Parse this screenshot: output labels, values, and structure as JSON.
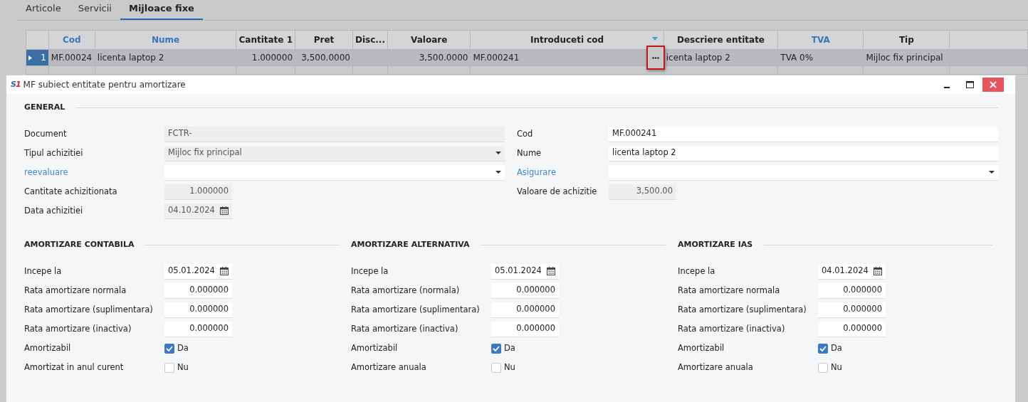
{
  "tabs": [
    {
      "label": "Articole",
      "selected": false
    },
    {
      "label": "Servicii",
      "selected": false
    },
    {
      "label": "Mijloace fixe",
      "selected": true
    }
  ],
  "grid": {
    "columns": [
      {
        "label": "Cod",
        "kind": "link",
        "menu": false
      },
      {
        "label": "Nume",
        "kind": "link",
        "menu": false
      },
      {
        "label": "Cantitate 1",
        "kind": "plain",
        "menu": false
      },
      {
        "label": "Pret",
        "kind": "plain",
        "menu": false
      },
      {
        "label": "Disc...",
        "kind": "plain",
        "menu": false
      },
      {
        "label": "Valoare",
        "kind": "plain",
        "menu": false
      },
      {
        "label": "Introduceti cod",
        "kind": "plain",
        "menu": true
      },
      {
        "label": "Descriere entitate",
        "kind": "plain",
        "menu": false
      },
      {
        "label": "TVA",
        "kind": "link",
        "menu": false
      },
      {
        "label": "Tip",
        "kind": "plain",
        "menu": false
      }
    ],
    "rows": [
      {
        "number": "1",
        "selected": true,
        "lookup_highlighted": true,
        "cells": [
          "MF.00024",
          "licenta laptop 2",
          "1.000000",
          "3,500.0000",
          "",
          "3,500.0000",
          "MF.000241",
          "icenta laptop 2",
          "TVA 0%",
          "Mijloc fix principal"
        ]
      }
    ]
  },
  "dialog": {
    "logo": "S1",
    "title": "MF subiect entitate pentru amortizare",
    "general": {
      "heading": "GENERAL",
      "left": [
        {
          "label": "Document",
          "kind": "text",
          "value": "FCTR-",
          "disabled": true,
          "link": false
        },
        {
          "label": "Tipul achizitiei",
          "kind": "select",
          "value": "Mijloc fix principal",
          "disabled": true,
          "link": false
        },
        {
          "label": "reevaluare",
          "kind": "select",
          "disabled": false,
          "link": true
        },
        {
          "label": "Cantitate achizitionata",
          "kind": "number",
          "value": "1.000000",
          "disabled": true,
          "link": false
        },
        {
          "label": "Data achizitiei",
          "kind": "date",
          "value": "04.10.2024",
          "disabled": true,
          "link": false
        }
      ],
      "right": [
        {
          "label": "Cod",
          "kind": "text",
          "value": "MF.000241",
          "disabled": false,
          "link": false
        },
        {
          "label": "Nume",
          "kind": "text",
          "value": "licenta laptop 2",
          "disabled": false,
          "link": false
        },
        {
          "label": "Asigurare",
          "kind": "select",
          "disabled": false,
          "link": true
        },
        {
          "label": "Valoare de achizitie",
          "kind": "number",
          "value": "3,500.00",
          "disabled": true,
          "link": false
        }
      ]
    },
    "sections": [
      {
        "heading": "AMORTIZARE CONTABILA",
        "fields": [
          {
            "label": "Incepe la",
            "kind": "date",
            "value": "05.01.2024",
            "disabled": false,
            "link": false
          },
          {
            "label": "Rata amortizare normala",
            "kind": "number",
            "value": "0.000000",
            "disabled": false,
            "link": false
          },
          {
            "label": "Rata amortizare (suplimentara)",
            "kind": "number",
            "value": "0.000000",
            "disabled": false,
            "link": false
          },
          {
            "label": "Rata amortizare (inactiva)",
            "kind": "number",
            "value": "0.000000",
            "disabled": false,
            "link": false
          },
          {
            "label": "Amortizabil",
            "kind": "checkbox",
            "checked": true,
            "caption": "Da"
          },
          {
            "label": "Amortizat in anul curent",
            "kind": "checkbox",
            "checked": false,
            "caption": "Nu"
          }
        ]
      },
      {
        "heading": "AMORTIZARE ALTERNATIVA",
        "fields": [
          {
            "label": "Incepe la",
            "kind": "date",
            "value": "05.01.2024",
            "disabled": false,
            "link": false
          },
          {
            "label": "Rata amortizare (normala)",
            "kind": "number",
            "value": "0.000000",
            "disabled": false,
            "link": false
          },
          {
            "label": "Rata amortizare (suplimentara)",
            "kind": "number",
            "value": "0.000000",
            "disabled": false,
            "link": false
          },
          {
            "label": "Rata amortizare (inactiva)",
            "kind": "number",
            "value": "0.000000",
            "disabled": false,
            "link": false
          },
          {
            "label": "Amortizabil",
            "kind": "checkbox",
            "checked": true,
            "caption": "Da"
          },
          {
            "label": "Amortizare anuala",
            "kind": "checkbox",
            "checked": false,
            "caption": "Nu"
          }
        ]
      },
      {
        "heading": "AMORTIZARE IAS",
        "fields": [
          {
            "label": "Incepe la",
            "kind": "date",
            "value": "04.01.2024",
            "disabled": false,
            "link": false
          },
          {
            "label": "Rata amortizare normala",
            "kind": "number",
            "value": "0.000000",
            "disabled": false,
            "link": false
          },
          {
            "label": "Rata amortizare (suplimentara)",
            "kind": "number",
            "value": "0.000000",
            "disabled": false,
            "link": false
          },
          {
            "label": "Rata amortizare (inactiva)",
            "kind": "number",
            "value": "0.000000",
            "disabled": false,
            "link": false
          },
          {
            "label": "Amortizabil",
            "kind": "checkbox",
            "checked": true,
            "caption": "Da"
          },
          {
            "label": "Amortizare anuala",
            "kind": "checkbox",
            "checked": false,
            "caption": "Nu"
          }
        ]
      }
    ]
  }
}
